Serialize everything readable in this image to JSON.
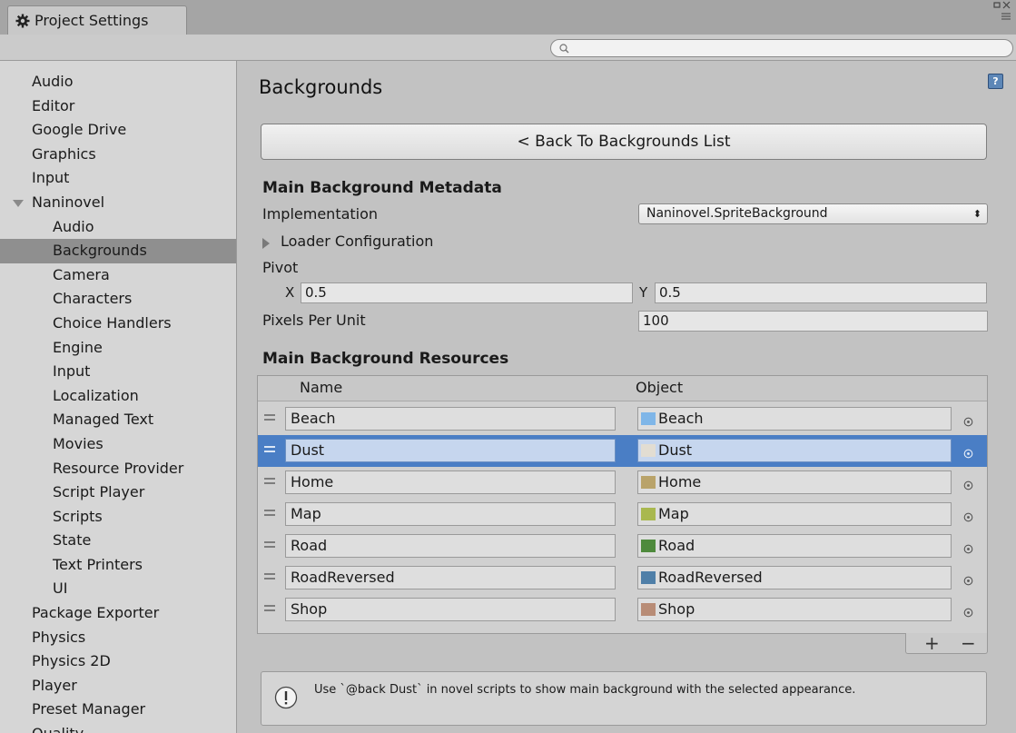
{
  "window": {
    "tab_title": "Project Settings"
  },
  "search": {
    "value": "",
    "placeholder": ""
  },
  "sidebar": {
    "items": [
      {
        "label": "Audio",
        "level": 0
      },
      {
        "label": "Editor",
        "level": 0
      },
      {
        "label": "Google Drive",
        "level": 0
      },
      {
        "label": "Graphics",
        "level": 0
      },
      {
        "label": "Input",
        "level": 0
      },
      {
        "label": "Naninovel",
        "level": 0,
        "expanded": true
      },
      {
        "label": "Audio",
        "level": 1
      },
      {
        "label": "Backgrounds",
        "level": 1,
        "selected": true
      },
      {
        "label": "Camera",
        "level": 1
      },
      {
        "label": "Characters",
        "level": 1
      },
      {
        "label": "Choice Handlers",
        "level": 1
      },
      {
        "label": "Engine",
        "level": 1
      },
      {
        "label": "Input",
        "level": 1
      },
      {
        "label": "Localization",
        "level": 1
      },
      {
        "label": "Managed Text",
        "level": 1
      },
      {
        "label": "Movies",
        "level": 1
      },
      {
        "label": "Resource Provider",
        "level": 1
      },
      {
        "label": "Script Player",
        "level": 1
      },
      {
        "label": "Scripts",
        "level": 1
      },
      {
        "label": "State",
        "level": 1
      },
      {
        "label": "Text Printers",
        "level": 1
      },
      {
        "label": "UI",
        "level": 1
      },
      {
        "label": "Package Exporter",
        "level": 0
      },
      {
        "label": "Physics",
        "level": 0
      },
      {
        "label": "Physics 2D",
        "level": 0
      },
      {
        "label": "Player",
        "level": 0
      },
      {
        "label": "Preset Manager",
        "level": 0
      },
      {
        "label": "Quality",
        "level": 0
      }
    ]
  },
  "main": {
    "title": "Backgrounds",
    "back_button": "< Back To Backgrounds List",
    "metadata": {
      "section_title": "Main Background Metadata",
      "implementation_label": "Implementation",
      "implementation_value": "Naninovel.SpriteBackground",
      "loader_label": "Loader Configuration",
      "pivot_label": "Pivot",
      "pivot_x_label": "X",
      "pivot_x": "0.5",
      "pivot_y_label": "Y",
      "pivot_y": "0.5",
      "ppu_label": "Pixels Per Unit",
      "ppu_value": "100"
    },
    "resources": {
      "section_title": "Main Background Resources",
      "col_name": "Name",
      "col_object": "Object",
      "rows": [
        {
          "name": "Beach",
          "object": "Beach",
          "thumb_color": "#7fb6e8",
          "selected": false
        },
        {
          "name": "Dust",
          "object": "Dust",
          "thumb_color": "#e2ddd2",
          "selected": true
        },
        {
          "name": "Home",
          "object": "Home",
          "thumb_color": "#b9a36a",
          "selected": false
        },
        {
          "name": "Map",
          "object": "Map",
          "thumb_color": "#a9b84f",
          "selected": false
        },
        {
          "name": "Road",
          "object": "Road",
          "thumb_color": "#4e8a3c",
          "selected": false
        },
        {
          "name": "RoadReversed",
          "object": "RoadReversed",
          "thumb_color": "#4f7fa8",
          "selected": false
        },
        {
          "name": "Shop",
          "object": "Shop",
          "thumb_color": "#b88c76",
          "selected": false
        }
      ],
      "add_label": "+",
      "remove_label": "−"
    },
    "info_message": "Use `@back Dust` in novel scripts to show main background with the selected appearance."
  },
  "colors": {
    "selection": "#4a7ec5",
    "sidebar_selection": "#8f8f8f"
  }
}
